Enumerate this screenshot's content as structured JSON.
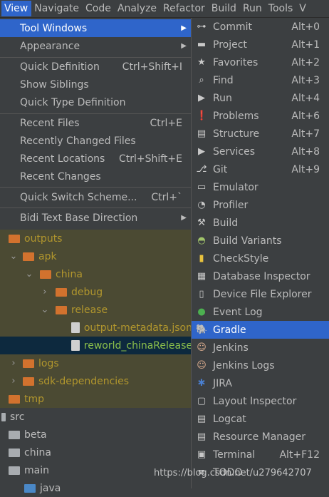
{
  "menubar": {
    "items": [
      "View",
      "Navigate",
      "Code",
      "Analyze",
      "Refactor",
      "Build",
      "Run",
      "Tools",
      "V"
    ]
  },
  "view_menu": {
    "items": [
      {
        "label": "Tool Windows",
        "shortcut": "",
        "submenu": true
      },
      {
        "label": "Appearance",
        "shortcut": "",
        "submenu": true
      },
      {
        "label": "Quick Definition",
        "shortcut": "Ctrl+Shift+I"
      },
      {
        "label": "Show Siblings",
        "shortcut": ""
      },
      {
        "label": "Quick Type Definition",
        "shortcut": ""
      },
      {
        "label": "Recent Files",
        "shortcut": "Ctrl+E"
      },
      {
        "label": "Recently Changed Files",
        "shortcut": ""
      },
      {
        "label": "Recent Locations",
        "shortcut": "Ctrl+Shift+E"
      },
      {
        "label": "Recent Changes",
        "shortcut": ""
      },
      {
        "label": "Quick Switch Scheme...",
        "shortcut": "Ctrl+`"
      },
      {
        "label": "Bidi Text Base Direction",
        "shortcut": "",
        "submenu": true
      }
    ]
  },
  "tool_windows": {
    "items": [
      {
        "label": "Commit",
        "shortcut": "Alt+0",
        "icon": "commit-icon",
        "glyph": "⊶"
      },
      {
        "label": "Project",
        "shortcut": "Alt+1",
        "icon": "folder-icon",
        "glyph": "▬"
      },
      {
        "label": "Favorites",
        "shortcut": "Alt+2",
        "icon": "star-icon",
        "glyph": "★"
      },
      {
        "label": "Find",
        "shortcut": "Alt+3",
        "icon": "search-icon",
        "glyph": "⌕"
      },
      {
        "label": "Run",
        "shortcut": "Alt+4",
        "icon": "play-icon",
        "glyph": "▶"
      },
      {
        "label": "Problems",
        "shortcut": "Alt+6",
        "icon": "warning-icon",
        "glyph": "❗"
      },
      {
        "label": "Structure",
        "shortcut": "Alt+7",
        "icon": "structure-icon",
        "glyph": "▤"
      },
      {
        "label": "Services",
        "shortcut": "Alt+8",
        "icon": "services-icon",
        "glyph": "▶"
      },
      {
        "label": "Git",
        "shortcut": "Alt+9",
        "icon": "git-icon",
        "glyph": "⎇"
      },
      {
        "label": "Emulator",
        "shortcut": "",
        "icon": "emulator-icon",
        "glyph": "▭"
      },
      {
        "label": "Profiler",
        "shortcut": "",
        "icon": "profiler-icon",
        "glyph": "◔"
      },
      {
        "label": "Build",
        "shortcut": "",
        "icon": "hammer-icon",
        "glyph": "⚒"
      },
      {
        "label": "Build Variants",
        "shortcut": "",
        "icon": "android-icon",
        "glyph": "◓"
      },
      {
        "label": "CheckStyle",
        "shortcut": "",
        "icon": "checkstyle-icon",
        "glyph": "▮"
      },
      {
        "label": "Database Inspector",
        "shortcut": "",
        "icon": "database-icon",
        "glyph": "▦"
      },
      {
        "label": "Device File Explorer",
        "shortcut": "",
        "icon": "device-icon",
        "glyph": "▯"
      },
      {
        "label": "Event Log",
        "shortcut": "",
        "icon": "event-log-icon",
        "glyph": "●"
      },
      {
        "label": "Gradle",
        "shortcut": "",
        "icon": "gradle-icon",
        "glyph": "🐘"
      },
      {
        "label": "Jenkins",
        "shortcut": "",
        "icon": "jenkins-icon",
        "glyph": "☺"
      },
      {
        "label": "Jenkins Logs",
        "shortcut": "",
        "icon": "jenkins-logs-icon",
        "glyph": "☺"
      },
      {
        "label": "JIRA",
        "shortcut": "",
        "icon": "jira-icon",
        "glyph": "✱"
      },
      {
        "label": "Layout Inspector",
        "shortcut": "",
        "icon": "layout-inspector-icon",
        "glyph": "▢"
      },
      {
        "label": "Logcat",
        "shortcut": "",
        "icon": "logcat-icon",
        "glyph": "▤"
      },
      {
        "label": "Resource Manager",
        "shortcut": "",
        "icon": "resource-manager-icon",
        "glyph": "▤"
      },
      {
        "label": "Terminal",
        "shortcut": "Alt+F12",
        "icon": "terminal-icon",
        "glyph": "▣"
      },
      {
        "label": "TODO",
        "shortcut": "",
        "icon": "todo-icon",
        "glyph": "≡"
      }
    ]
  },
  "project_tree": {
    "rows": [
      {
        "label": "outputs",
        "arrow": "",
        "icon": "folder-orange"
      },
      {
        "label": "apk",
        "arrow": "⌄",
        "icon": "folder-orange"
      },
      {
        "label": "china",
        "arrow": "⌄",
        "icon": "folder-orange"
      },
      {
        "label": "debug",
        "arrow": "›",
        "icon": "folder-orange"
      },
      {
        "label": "release",
        "arrow": "⌄",
        "icon": "folder-orange"
      },
      {
        "label": "output-metadata.json",
        "arrow": "",
        "icon": "file"
      },
      {
        "label": "reworld_chinaRelease",
        "arrow": "",
        "icon": "file"
      },
      {
        "label": "logs",
        "arrow": "›",
        "icon": "folder-orange"
      },
      {
        "label": "sdk-dependencies",
        "arrow": "›",
        "icon": "folder-orange"
      },
      {
        "label": "tmp",
        "arrow": "",
        "icon": "folder-orange"
      },
      {
        "label": "src",
        "arrow": "",
        "icon": "folder-grey"
      },
      {
        "label": "beta",
        "arrow": "",
        "icon": "folder-grey"
      },
      {
        "label": "china",
        "arrow": "",
        "icon": "folder-grey"
      },
      {
        "label": "main",
        "arrow": "",
        "icon": "folder-grey"
      },
      {
        "label": "java",
        "arrow": "",
        "icon": "folder-blue"
      }
    ]
  },
  "watermark": "https://blog.csdn.net/u279642707"
}
